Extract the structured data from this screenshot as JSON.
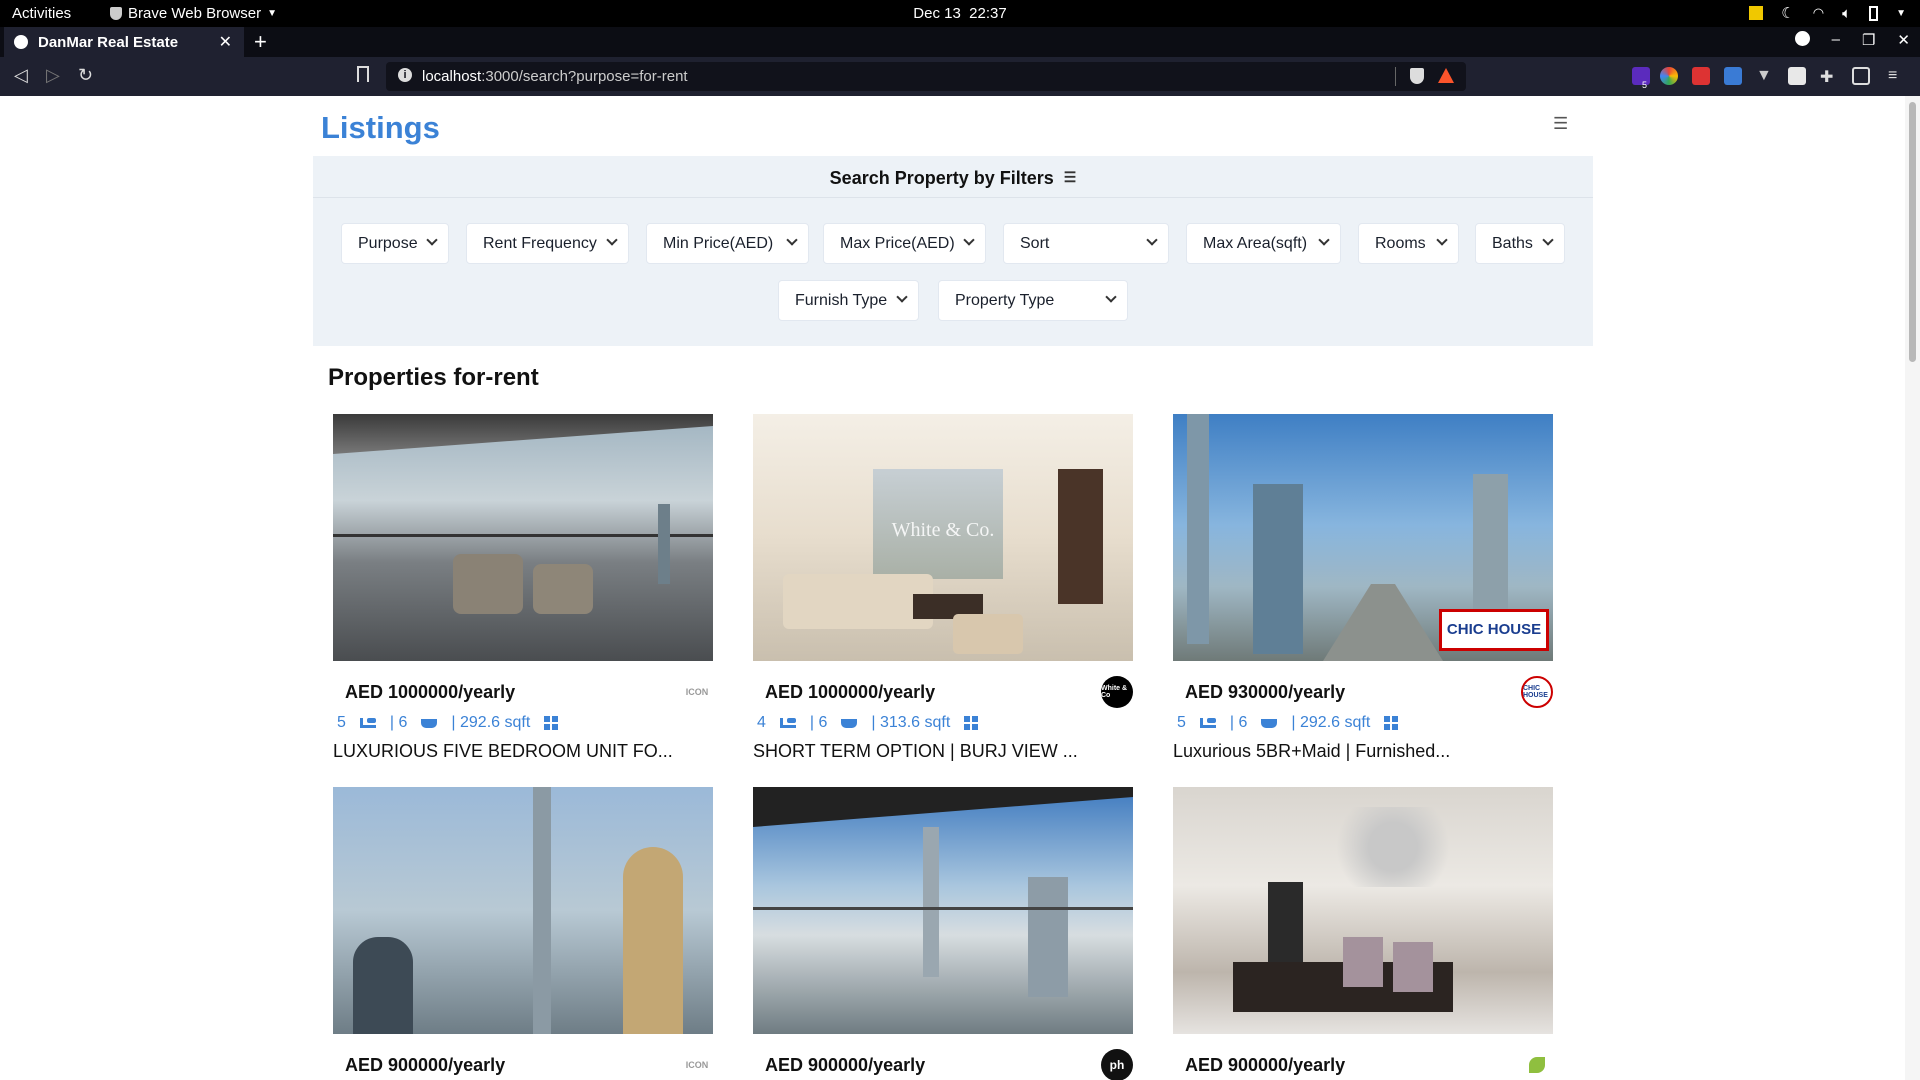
{
  "system": {
    "activities": "Activities",
    "app_name": "Brave Web Browser",
    "date": "Dec 13",
    "time": "22:37"
  },
  "browser": {
    "tab_title": "DanMar Real Estate",
    "url_host": "localhost",
    "url_rest": ":3000/search?purpose=for-rent",
    "ext_badge": "5"
  },
  "page": {
    "brand": "Listings",
    "filters_title": "Search Property by Filters",
    "filters": [
      "Purpose",
      "Rent Frequency",
      "Min Price(AED)",
      "Max Price(AED)",
      "Sort",
      "Max Area(sqft)",
      "Rooms",
      "Baths",
      "Furnish Type",
      "Property Type"
    ],
    "section_title": "Properties for-rent",
    "listings": [
      {
        "price": "AED 1000000/yearly",
        "rooms": "5",
        "baths": "| 6",
        "area": "| 292.6 sqft",
        "title": "LUXURIOUS FIVE BEDROOM UNIT FO...",
        "agent": "ICON"
      },
      {
        "price": "AED 1000000/yearly",
        "rooms": "4",
        "baths": "| 6",
        "area": "| 313.6 sqft",
        "title": "SHORT TERM OPTION | BURJ VIEW ...",
        "agent": "White & Co"
      },
      {
        "price": "AED 930000/yearly",
        "rooms": "5",
        "baths": "| 6",
        "area": "| 292.6 sqft",
        "title": "Luxurious 5BR+Maid | Furnished...",
        "agent": "CHIC HOUSE"
      },
      {
        "price": "AED 900000/yearly",
        "rooms": "",
        "baths": "",
        "area": "",
        "title": "",
        "agent": "ICON"
      },
      {
        "price": "AED 900000/yearly",
        "rooms": "",
        "baths": "",
        "area": "",
        "title": "",
        "agent": "ph"
      },
      {
        "price": "AED 900000/yearly",
        "rooms": "",
        "baths": "",
        "area": "",
        "title": "",
        "agent": ""
      }
    ],
    "watermarks": {
      "card2": "White & Co.",
      "card3": "CHIC HOUSE"
    }
  }
}
